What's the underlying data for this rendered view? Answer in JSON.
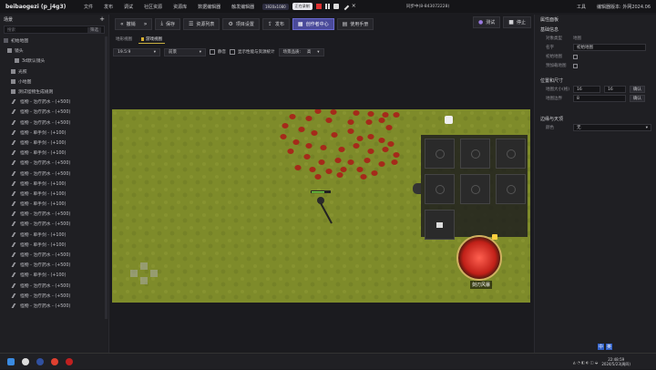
{
  "app": {
    "title": "beibaogezi (p_j4g3)"
  },
  "menu": [
    "文件",
    "发布",
    "调试",
    "社区资源",
    "资源库",
    "数据编辑器",
    "触发编辑器"
  ],
  "menu_right": [
    "工具",
    "编辑器版本: 外网2024.06"
  ],
  "recording": {
    "resolution": "1920x1080",
    "status": "正在录制"
  },
  "status_text": "同步中(8-843072228)",
  "toolbar": {
    "back": "撤销",
    "save": "保存",
    "resource_list": "资源列表",
    "project_settings": "项目设置",
    "publish": "发布",
    "creator_center": "创作者中心",
    "manual": "使用手册",
    "test": "测试",
    "stop": "停止"
  },
  "left_panel": {
    "header": "场景",
    "search_placeholder": "搜索",
    "search_btn": "筛选",
    "tree": [
      "初始地图",
      "镜头",
      "3d默认镜头",
      "光照",
      "小地图",
      "测试怪物生成规则",
      "怪物 - 治疗药水 - (+500)",
      "怪物 - 治疗药水 - (+500)",
      "怪物 - 治疗药水 - (+500)",
      "怪物 - 单手剑 - (+100)",
      "怪物 - 单手剑 - (+100)",
      "怪物 - 单手剑 - (+100)",
      "怪物 - 治疗药水 - (+500)",
      "怪物 - 治疗药水 - (+500)",
      "怪物 - 单手剑 - (+100)",
      "怪物 - 单手剑 - (+100)",
      "怪物 - 单手剑 - (+100)",
      "怪物 - 治疗药水 - (+500)",
      "怪物 - 治疗药水 - (+500)",
      "怪物 - 单手剑 - (+100)",
      "怪物 - 单手剑 - (+100)",
      "怪物 - 治疗药水 - (+500)",
      "怪物 - 治疗药水 - (+500)",
      "怪物 - 单手剑 - (+100)",
      "怪物 - 治疗药水 - (+500)",
      "怪物 - 治疗药水 - (+500)",
      "怪物 - 治疗药水 - (+500)"
    ]
  },
  "tabs": [
    "地形视图",
    "游戏视图"
  ],
  "scene_bar": {
    "zoom": "19.5:9",
    "view": "前景",
    "mute": "静音",
    "show_stats": "显示性能与资源统计",
    "quality_label": "场景品质:",
    "quality": "高"
  },
  "game": {
    "skill_label": "剑刃风暴"
  },
  "right_panel": {
    "title": "属性面板",
    "basic": "基础信息",
    "object_type_lbl": "对象类型",
    "object_type": "地图",
    "name_lbl": "名字",
    "name": "初始地图",
    "initial_lbl": "初始地图",
    "preload_lbl": "预加载地图",
    "pos_size": "位置和尺寸",
    "map_size_lbl": "地图大小(格)",
    "map_w": "16",
    "map_h": "16",
    "confirm": "确认",
    "region_lbl": "地图边界",
    "region": "8",
    "edge": "边缘与天顶",
    "color_lbl": "颜色",
    "color": "无"
  },
  "taskbar": {
    "time": "22:48:59",
    "date": "2024/5/23(周四)"
  },
  "ime": [
    "中",
    "英"
  ],
  "colors": {
    "grass": "#7e8b2a",
    "accent": "#4a4a9a",
    "monster": "#a52a1a"
  },
  "chart_data": null
}
